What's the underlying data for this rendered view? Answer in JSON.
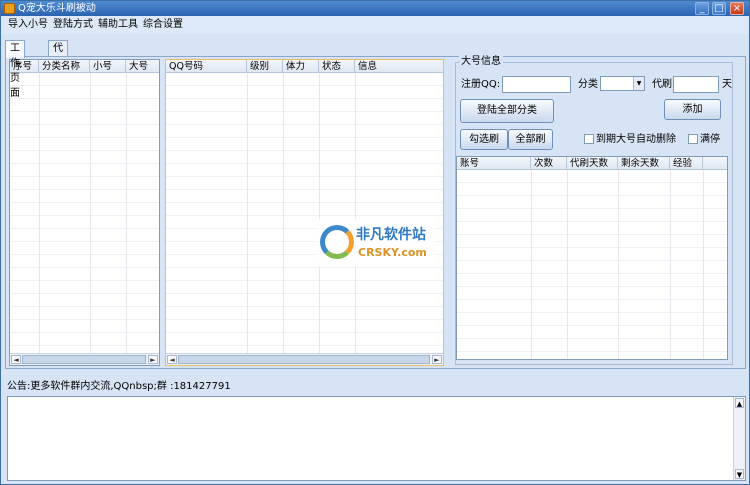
{
  "window": {
    "title": "Q宠大乐斗刷被动",
    "controls": {
      "minimize": "_",
      "maximize": "□",
      "close": "×"
    }
  },
  "menu": [
    "导入小号",
    "登陆方式",
    "辅助工具",
    "综合设置"
  ],
  "tabs": [
    {
      "label": "工作页面",
      "active": true
    },
    {
      "label": "代刷号码管理",
      "active": false
    }
  ],
  "category_table": {
    "columns": [
      "序号",
      "分类名称",
      "小号",
      "大号"
    ],
    "rows": []
  },
  "qq_table": {
    "columns": [
      "QQ号码",
      "级别",
      "体力",
      "状态",
      "信息"
    ],
    "rows": []
  },
  "main_account": {
    "group_title": "大号信息",
    "qq_label": "注册QQ:",
    "qq_value": "",
    "category_label": "分类",
    "category_value": "",
    "days_label_prefix": "代刷",
    "days_value": "",
    "days_unit": "天",
    "login_all_button": "登陆全部分类",
    "add_button": "添加",
    "select_button": "勾选刷",
    "all_button": "全部刷",
    "auto_delete_label": "到期大号自动删除",
    "auto_delete_checked": false,
    "full_stop_label": "满停",
    "full_stop_checked": false,
    "table": {
      "columns": [
        "账号",
        "次数",
        "代刷天数",
        "剩余天数",
        "经验"
      ],
      "rows": []
    }
  },
  "notice": "公告:更多软件群内交流,QQnbsp;群 :181427791",
  "log_text": "",
  "watermark": {
    "cn": "非凡软件站",
    "en": "CRSKY.com"
  },
  "scroll_arrows": {
    "left": "◄",
    "right": "►",
    "up": "▲",
    "down": "▼",
    "dropdown": "▼"
  },
  "colors": {
    "titlebar": "#2a62ae",
    "panel": "#d6e4f5",
    "border": "#7f9db9",
    "watermark_blue": "#1e6fc0",
    "watermark_orange": "#d88a14"
  }
}
